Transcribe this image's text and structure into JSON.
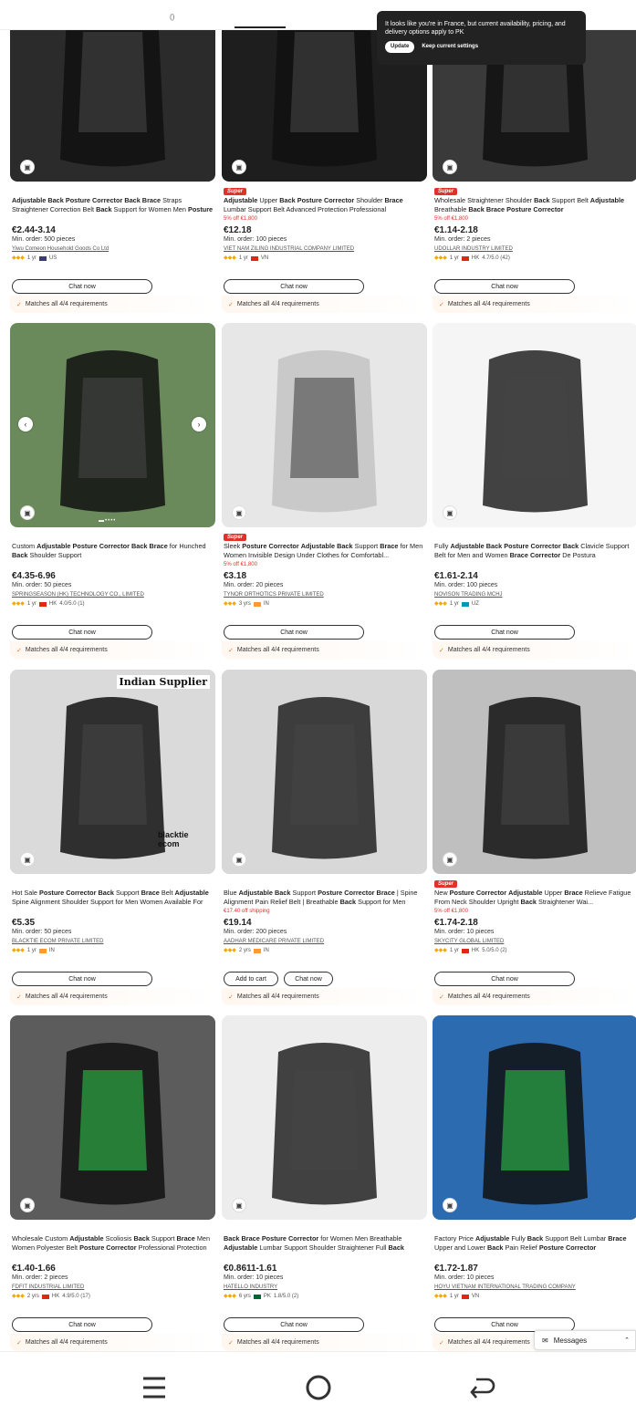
{
  "popup": {
    "message": "It looks like you're in France, but current availability, pricing, and delivery options apply to PK",
    "update_label": "Update",
    "keep_label": "Keep current settings"
  },
  "common": {
    "chat_now": "Chat now",
    "add_to_cart": "Add to cart",
    "requirements": "Matches all 4/4 requirements",
    "super_badge": "Super"
  },
  "products": [
    {
      "title": "Adjustable Back Posture Corrector Back Brace Straps Straightener Correction Belt Back Support for Women Men Posture Corrector",
      "promo": "",
      "price": "€2.44-3.14",
      "moq": "Min. order: 500 pieces",
      "supplier": "Yiwu Comeon Household Goods Co Ltd",
      "years": "1 yr",
      "country": "US",
      "rating": "",
      "super": false
    },
    {
      "title": "Adjustable Upper Back Posture Corrector Shoulder Brace Lumbar Support Belt Advanced Protection Professional",
      "promo": "5% off €1,800",
      "price": "€12.18",
      "moq": "Min. order: 100 pieces",
      "supplier": "VIET NAM ZILING INDUSTRIAL COMPANY LIMITED",
      "years": "1 yr",
      "country": "VN",
      "rating": "",
      "super": true
    },
    {
      "title": "Wholesale Straightener Shoulder Back Support Belt Adjustable Breathable Back Brace Posture Corrector",
      "promo": "5% off €1,800",
      "price": "€1.14-2.18",
      "moq": "Min. order: 2 pieces",
      "supplier": "UDOLLAR INDUSTRY LIMITED",
      "years": "1 yr",
      "country": "HK",
      "rating": "4.7/5.0 (42)",
      "super": true
    },
    {
      "title": "Custom Adjustable Posture Corrector Back Brace for Hunched Back Shoulder Support",
      "promo": "",
      "price": "€4.35-6.96",
      "moq": "Min. order: 50 pieces",
      "supplier": "SPRINGSEASON (HK) TECHNOLOGY CO., LIMITED",
      "years": "1 yr",
      "country": "HK",
      "rating": "4.0/5.0 (1)",
      "super": false
    },
    {
      "title": "Sleek Posture Corrector Adjustable Back Support Brace for Men Women Invisible Design Under Clothes for Comfortabl...",
      "promo": "5% off €1,800",
      "price": "€3.18",
      "moq": "Min. order: 20 pieces",
      "supplier": "TYNOR ORTHOTICS PRIVATE LIMITED",
      "years": "3 yrs",
      "country": "IN",
      "rating": "",
      "super": true
    },
    {
      "title": "Fully Adjustable Back Posture Corrector Back Clavicle Support Belt for Men and Women Brace Corrector De Postura",
      "promo": "",
      "price": "€1.61-2.14",
      "moq": "Min. order: 100 pieces",
      "supplier": "NOVISON TRADING MCHJ",
      "years": "1 yr",
      "country": "UZ",
      "rating": "",
      "super": false
    },
    {
      "title": "Hot Sale Posture Corrector Back Support Brace Belt Adjustable Spine Alignment Shoulder Support for Men Women Available For Sale",
      "promo": "",
      "price": "€5.35",
      "moq": "Min. order: 50 pieces",
      "supplier": "BLACKTIE ECOM PRIVATE LIMITED",
      "years": "1 yr",
      "country": "IN",
      "rating": "",
      "super": false
    },
    {
      "title": "Blue Adjustable Back Support Posture Corrector Brace | Spine Alignment Pain Relief Belt | Breathable Back Support for Men Women",
      "promo": "€17.40 off shipping",
      "price": "€19.14",
      "moq": "Min. order: 200 pieces",
      "supplier": "AADHAR MEDICARE PRIVATE LIMITED",
      "years": "2 yrs",
      "country": "IN",
      "rating": "",
      "super": false
    },
    {
      "title": "New Posture Corrector Adjustable Upper Brace Relieve Fatigue From Neck Shoulder Upright Back Straightener Wai...",
      "promo": "5% off €1,800",
      "price": "€1.74-2.18",
      "moq": "Min. order: 10 pieces",
      "supplier": "SKYCITY GLOBAL LIMITED",
      "years": "1 yr",
      "country": "HK",
      "rating": "5.0/5.0 (2)",
      "super": true
    },
    {
      "title": "Wholesale Custom Adjustable Scoliosis Back Support Brace Men Women Polyester Belt Posture Corrector Professional Protection",
      "promo": "",
      "price": "€1.40-1.66",
      "moq": "Min. order: 2 pieces",
      "supplier": "FDFIT INDUSTRIAL LIMITED",
      "years": "2 yrs",
      "country": "HK",
      "rating": "4.9/5.0 (17)",
      "super": false
    },
    {
      "title": "Back Brace Posture Corrector for Women Men Breathable Adjustable Lumbar Support Shoulder Straightener Full Back Support Upper",
      "promo": "",
      "price": "€0.8611-1.61",
      "moq": "Min. order: 10 pieces",
      "supplier": "HATELLO INDUSTRY",
      "years": "6 yrs",
      "country": "PK",
      "rating": "1.8/5.0 (2)",
      "super": false
    },
    {
      "title": "Factory Price Adjustable Fully Back Support Belt Lumbar Brace Upper and Lower Back Pain Relief Posture Corrector",
      "promo": "",
      "price": "€1.72-1.87",
      "moq": "Min. order: 10 pieces",
      "supplier": "HOYU VIETNAM INTERNATIONAL TRADING COMPANY",
      "years": "1 yr",
      "country": "VN",
      "rating": "",
      "super": false
    }
  ],
  "overlay_texts": {
    "indian_supplier": "Indian Supplier",
    "blacktie": "blacktie ecom"
  },
  "messages": {
    "label": "Messages"
  },
  "colors": {
    "accent": "#e0312a",
    "orange": "#f7a800"
  }
}
